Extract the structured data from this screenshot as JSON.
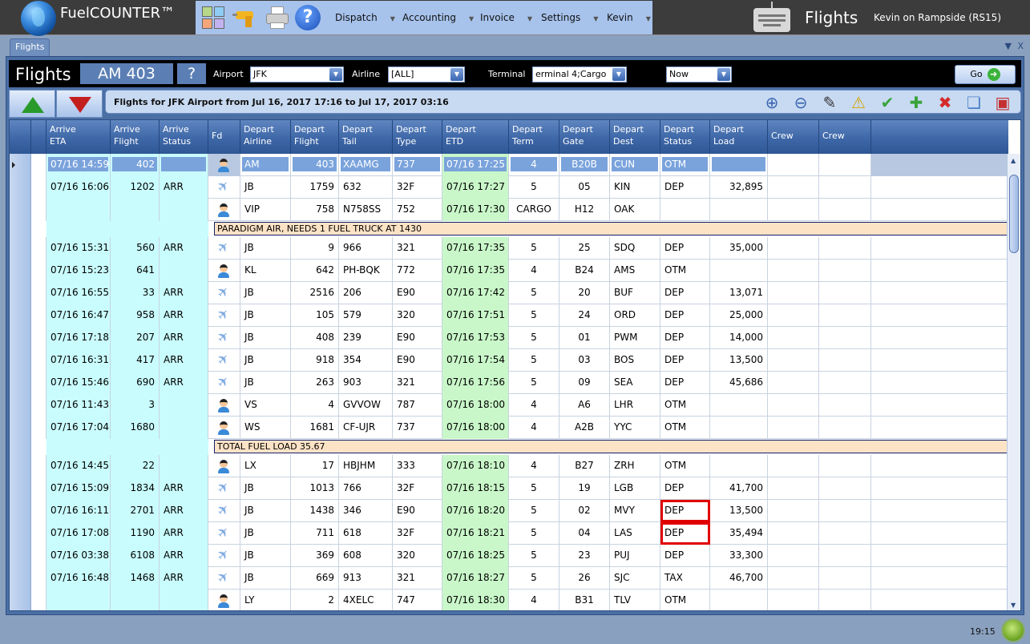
{
  "app": {
    "title": "FuelCOUNTER™",
    "screen_title": "Flights",
    "user_info": "Kevin on Rampside (RS15)",
    "menu": [
      {
        "label": "Dispatch"
      },
      {
        "label": "Accounting"
      },
      {
        "label": "Invoice"
      },
      {
        "label": "Settings"
      },
      {
        "label": "Kevin"
      }
    ],
    "toolbar_icons": [
      "module-grid-icon",
      "drill-icon",
      "printer-icon",
      "help-icon"
    ]
  },
  "tabs": [
    {
      "label": "Flights",
      "active": true
    }
  ],
  "tab_controls": {
    "dropdown": "▼",
    "close": "X"
  },
  "filter": {
    "title": "Flights",
    "selected_flight": "AM 403",
    "query_label": "?",
    "airport_label": "Airport",
    "airport_value": "JFK",
    "airline_label": "Airline",
    "airline_value": "[ALL]",
    "terminal_label": "Terminal",
    "terminal_value": "erminal 4;Cargo",
    "time_value": "Now",
    "go_label": "Go"
  },
  "info_text": "Flights for JFK Airport from Jul 16, 2017 17:16 to Jul 17, 2017 03:16",
  "actions": [
    {
      "name": "zoom-in-icon",
      "glyph": "⊕",
      "color": "#3a66b0"
    },
    {
      "name": "zoom-out-icon",
      "glyph": "⊖",
      "color": "#3a66b0"
    },
    {
      "name": "notepad-icon",
      "glyph": "✎",
      "color": "#333"
    },
    {
      "name": "warning-icon",
      "glyph": "⚠",
      "color": "#d9a400"
    },
    {
      "name": "checkmark-icon",
      "glyph": "✔",
      "color": "#3aa33a"
    },
    {
      "name": "add-icon",
      "glyph": "✚",
      "color": "#3aa33a"
    },
    {
      "name": "delete-icon",
      "glyph": "✖",
      "color": "#d42a2a"
    },
    {
      "name": "new-document-icon",
      "glyph": "❏",
      "color": "#4a80c8"
    },
    {
      "name": "package-icon",
      "glyph": "▣",
      "color": "#c43030"
    }
  ],
  "columns": [
    {
      "line1": "Arrive",
      "line2": "ETA"
    },
    {
      "line1": "Arrive",
      "line2": "Flight"
    },
    {
      "line1": "Arrive",
      "line2": "Status"
    },
    {
      "line1": "Fd",
      "line2": ""
    },
    {
      "line1": "Depart",
      "line2": "Airline"
    },
    {
      "line1": "Depart",
      "line2": "Flight"
    },
    {
      "line1": "Depart",
      "line2": "Tail"
    },
    {
      "line1": "Depart",
      "line2": "Type"
    },
    {
      "line1": "Depart",
      "line2": "ETD"
    },
    {
      "line1": "Depart",
      "line2": "Term"
    },
    {
      "line1": "Depart",
      "line2": "Gate"
    },
    {
      "line1": "Depart",
      "line2": "Dest"
    },
    {
      "line1": "Depart",
      "line2": "Status"
    },
    {
      "line1": "Depart",
      "line2": "Load"
    },
    {
      "line1": "Crew",
      "line2": ""
    },
    {
      "line1": "Crew",
      "line2": ""
    }
  ],
  "rows": [
    {
      "type": "flight",
      "selected": true,
      "eta": "07/16 14:59",
      "arr_flight": "402",
      "arr_status": "",
      "fd": "person",
      "airline": "AM",
      "dep_flight": "403",
      "tail": "XAAMG",
      "actype": "737",
      "etd": "07/16 17:25",
      "term": "4",
      "gate": "B20B",
      "dest": "CUN",
      "status": "OTM",
      "load": "",
      "crew1": "",
      "crew2": ""
    },
    {
      "type": "flight",
      "eta": "07/16 16:06",
      "arr_flight": "1202",
      "arr_status": "ARR",
      "fd": "plane",
      "airline": "JB",
      "dep_flight": "1759",
      "tail": "632",
      "actype": "32F",
      "etd": "07/16 17:27",
      "term": "5",
      "gate": "05",
      "dest": "KIN",
      "status": "DEP",
      "load": "32,895",
      "crew1": "",
      "crew2": ""
    },
    {
      "type": "flight",
      "eta": "",
      "arr_flight": "",
      "arr_status": "",
      "fd": "person",
      "airline": "VIP",
      "dep_flight": "758",
      "tail": "N758SS",
      "actype": "752",
      "etd": "07/16 17:30",
      "term": "CARGO",
      "gate": "H12",
      "dest": "OAK",
      "status": "",
      "load": "",
      "crew1": "",
      "crew2": ""
    },
    {
      "type": "note",
      "text": "PARADIGM AIR, NEEDS 1 FUEL TRUCK AT 1430"
    },
    {
      "type": "flight",
      "eta": "07/16 15:31",
      "arr_flight": "560",
      "arr_status": "ARR",
      "fd": "plane",
      "airline": "JB",
      "dep_flight": "9",
      "tail": "966",
      "actype": "321",
      "etd": "07/16 17:35",
      "term": "5",
      "gate": "25",
      "dest": "SDQ",
      "status": "DEP",
      "load": "35,000",
      "crew1": "",
      "crew2": ""
    },
    {
      "type": "flight",
      "eta": "07/16 15:23",
      "arr_flight": "641",
      "arr_status": "",
      "fd": "person",
      "airline": "KL",
      "dep_flight": "642",
      "tail": "PH-BQK",
      "actype": "772",
      "etd": "07/16 17:35",
      "term": "4",
      "gate": "B24",
      "dest": "AMS",
      "status": "OTM",
      "load": "",
      "crew1": "",
      "crew2": ""
    },
    {
      "type": "flight",
      "eta": "07/16 16:55",
      "arr_flight": "33",
      "arr_status": "ARR",
      "fd": "plane",
      "airline": "JB",
      "dep_flight": "2516",
      "tail": "206",
      "actype": "E90",
      "etd": "07/16 17:42",
      "term": "5",
      "gate": "20",
      "dest": "BUF",
      "status": "DEP",
      "load": "13,071",
      "crew1": "",
      "crew2": ""
    },
    {
      "type": "flight",
      "eta": "07/16 16:47",
      "arr_flight": "958",
      "arr_status": "ARR",
      "fd": "plane",
      "airline": "JB",
      "dep_flight": "105",
      "tail": "579",
      "actype": "320",
      "etd": "07/16 17:51",
      "term": "5",
      "gate": "24",
      "dest": "ORD",
      "status": "DEP",
      "load": "25,000",
      "crew1": "",
      "crew2": ""
    },
    {
      "type": "flight",
      "eta": "07/16 17:18",
      "arr_flight": "207",
      "arr_status": "ARR",
      "fd": "plane",
      "airline": "JB",
      "dep_flight": "408",
      "tail": "239",
      "actype": "E90",
      "etd": "07/16 17:53",
      "term": "5",
      "gate": "01",
      "dest": "PWM",
      "status": "DEP",
      "load": "14,000",
      "crew1": "",
      "crew2": ""
    },
    {
      "type": "flight",
      "eta": "07/16 16:31",
      "arr_flight": "417",
      "arr_status": "ARR",
      "fd": "plane",
      "airline": "JB",
      "dep_flight": "918",
      "tail": "354",
      "actype": "E90",
      "etd": "07/16 17:54",
      "term": "5",
      "gate": "03",
      "dest": "BOS",
      "status": "DEP",
      "load": "13,500",
      "crew1": "",
      "crew2": ""
    },
    {
      "type": "flight",
      "eta": "07/16 15:46",
      "arr_flight": "690",
      "arr_status": "ARR",
      "fd": "plane",
      "airline": "JB",
      "dep_flight": "263",
      "tail": "903",
      "actype": "321",
      "etd": "07/16 17:56",
      "term": "5",
      "gate": "09",
      "dest": "SEA",
      "status": "DEP",
      "load": "45,686",
      "crew1": "",
      "crew2": ""
    },
    {
      "type": "flight",
      "eta": "07/16 11:43",
      "arr_flight": "3",
      "arr_status": "",
      "fd": "person",
      "airline": "VS",
      "dep_flight": "4",
      "tail": "GVVOW",
      "actype": "787",
      "etd": "07/16 18:00",
      "term": "4",
      "gate": "A6",
      "dest": "LHR",
      "status": "OTM",
      "load": "",
      "crew1": "",
      "crew2": ""
    },
    {
      "type": "flight",
      "eta": "07/16 17:04",
      "arr_flight": "1680",
      "arr_status": "",
      "fd": "person",
      "airline": "WS",
      "dep_flight": "1681",
      "tail": "CF-UJR",
      "actype": "737",
      "etd": "07/16 18:00",
      "term": "4",
      "gate": "A2B",
      "dest": "YYC",
      "status": "OTM",
      "load": "",
      "crew1": "",
      "crew2": ""
    },
    {
      "type": "note",
      "text": "TOTAL FUEL LOAD 35.67"
    },
    {
      "type": "flight",
      "eta": "07/16 14:45",
      "arr_flight": "22",
      "arr_status": "",
      "fd": "person",
      "airline": "LX",
      "dep_flight": "17",
      "tail": "HBJHM",
      "actype": "333",
      "etd": "07/16 18:10",
      "term": "4",
      "gate": "B27",
      "dest": "ZRH",
      "status": "OTM",
      "load": "",
      "crew1": "",
      "crew2": ""
    },
    {
      "type": "flight",
      "eta": "07/16 15:09",
      "arr_flight": "1834",
      "arr_status": "ARR",
      "fd": "plane",
      "airline": "JB",
      "dep_flight": "1013",
      "tail": "766",
      "actype": "32F",
      "etd": "07/16 18:15",
      "term": "5",
      "gate": "19",
      "dest": "LGB",
      "status": "DEP",
      "load": "41,700",
      "crew1": "",
      "crew2": ""
    },
    {
      "type": "flight",
      "eta": "07/16 16:11",
      "arr_flight": "2701",
      "arr_status": "ARR",
      "fd": "plane",
      "airline": "JB",
      "dep_flight": "1438",
      "tail": "346",
      "actype": "E90",
      "etd": "07/16 18:20",
      "term": "5",
      "gate": "02",
      "dest": "MVY",
      "status": "DEP",
      "status_flag": true,
      "load": "13,500",
      "crew1": "",
      "crew2": ""
    },
    {
      "type": "flight",
      "eta": "07/16 17:08",
      "arr_flight": "1190",
      "arr_status": "ARR",
      "fd": "plane",
      "airline": "JB",
      "dep_flight": "711",
      "tail": "618",
      "actype": "32F",
      "etd": "07/16 18:21",
      "term": "5",
      "gate": "04",
      "dest": "LAS",
      "status": "DEP",
      "status_flag": true,
      "load": "35,494",
      "crew1": "",
      "crew2": ""
    },
    {
      "type": "flight",
      "eta": "07/16 03:38",
      "arr_flight": "6108",
      "arr_status": "ARR",
      "fd": "plane",
      "airline": "JB",
      "dep_flight": "369",
      "tail": "608",
      "actype": "320",
      "etd": "07/16 18:25",
      "term": "5",
      "gate": "23",
      "dest": "PUJ",
      "status": "DEP",
      "load": "33,300",
      "crew1": "",
      "crew2": ""
    },
    {
      "type": "flight",
      "eta": "07/16 16:48",
      "arr_flight": "1468",
      "arr_status": "ARR",
      "fd": "plane",
      "airline": "JB",
      "dep_flight": "669",
      "tail": "913",
      "actype": "321",
      "etd": "07/16 18:27",
      "term": "5",
      "gate": "26",
      "dest": "SJC",
      "status": "TAX",
      "load": "46,700",
      "crew1": "",
      "crew2": ""
    },
    {
      "type": "flight",
      "eta": "",
      "arr_flight": "",
      "arr_status": "",
      "fd": "person",
      "airline": "LY",
      "dep_flight": "2",
      "tail": "4XELC",
      "actype": "747",
      "etd": "07/16 18:30",
      "term": "4",
      "gate": "B31",
      "dest": "TLV",
      "status": "OTM",
      "load": "",
      "crew1": "",
      "crew2": ""
    }
  ],
  "status_bar": {
    "time": "19:15",
    "connection": "connected"
  },
  "colors": {
    "arrive_bg": "#c9fcfd",
    "etd_bg": "#c9f7c9",
    "note_bg": "#fde3c6",
    "selected_bg": "#7aa3dc",
    "flag_border": "#e00000",
    "header_bg": "#3e67a7"
  }
}
